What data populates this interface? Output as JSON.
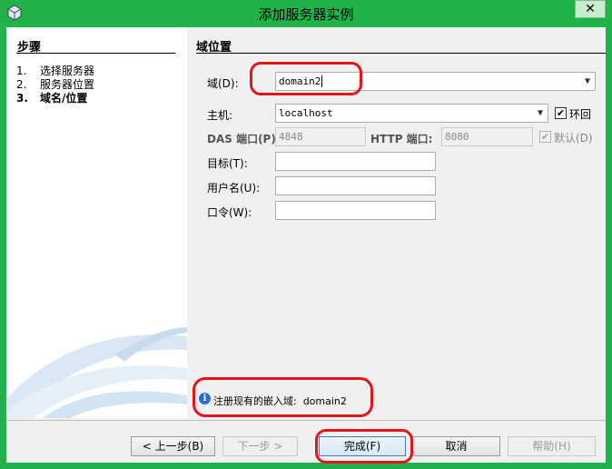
{
  "window": {
    "title": "添加服务器实例",
    "close_glyph": "✕"
  },
  "steps": {
    "title": "步骤",
    "items": [
      {
        "num": "1.",
        "label": "选择服务器"
      },
      {
        "num": "2.",
        "label": "服务器位置"
      },
      {
        "num": "3.",
        "label": "域名/位置"
      }
    ],
    "current_index": 2
  },
  "panel": {
    "title": "域位置",
    "domain": {
      "label": "域(D):",
      "value": "domain2"
    },
    "host": {
      "label": "主机:",
      "value": "localhost",
      "loopback_label": "环回",
      "loopback_checked": true
    },
    "das_port": {
      "label": "DAS 端口(P):",
      "value": "4848"
    },
    "http_port": {
      "label": "HTTP 端口:",
      "value": "8080"
    },
    "default": {
      "label": "默认(D)",
      "checked": true
    },
    "target": {
      "label": "目标(T):",
      "value": ""
    },
    "username": {
      "label": "用户名(U):",
      "value": ""
    },
    "password": {
      "label": "口令(W):",
      "value": ""
    },
    "info": {
      "text": "注册现有的嵌入域:  domain2"
    }
  },
  "buttons": {
    "back": "< 上一步(B)",
    "next": "下一步 >",
    "finish": "完成(F)",
    "cancel": "取消",
    "help": "帮助(H)"
  },
  "colors": {
    "frame": "#22b14c",
    "highlight": "#e2141c"
  }
}
